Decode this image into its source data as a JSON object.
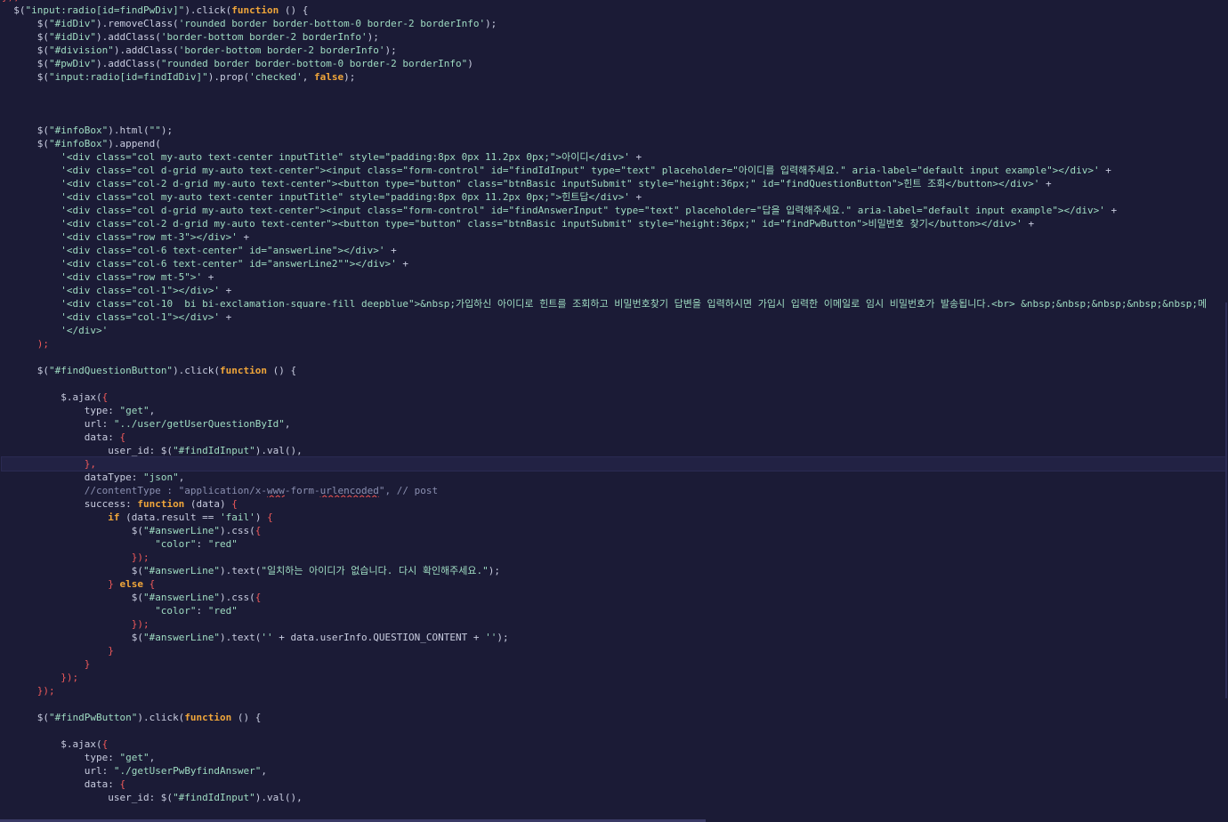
{
  "colors": {
    "background": "#1b1b36",
    "current_line": "#222244",
    "plain": "#c9cde0",
    "string": "#9fdcc2",
    "keyword": "#f0a63a",
    "punctuation": "#f05a5a",
    "comment": "#8a8fb0"
  },
  "editor": {
    "current_line_index": 35,
    "lines": [
      [
        [
          "punc",
          "});"
        ]
      ],
      [
        [
          "plain",
          "  $("
        ],
        [
          "str",
          "\"input:radio[id=findPwDiv]\""
        ],
        [
          "plain",
          ").click("
        ],
        [
          "kw",
          "function"
        ],
        [
          "plain",
          " () {"
        ]
      ],
      [
        [
          "plain",
          "      $("
        ],
        [
          "str",
          "\"#idDiv\""
        ],
        [
          "plain",
          ").removeClass("
        ],
        [
          "str",
          "'rounded border border-bottom-0 border-2 borderInfo'"
        ],
        [
          "plain",
          ");"
        ]
      ],
      [
        [
          "plain",
          "      $("
        ],
        [
          "str",
          "\"#idDiv\""
        ],
        [
          "plain",
          ").addClass("
        ],
        [
          "str",
          "'border-bottom border-2 borderInfo'"
        ],
        [
          "plain",
          ");"
        ]
      ],
      [
        [
          "plain",
          "      $("
        ],
        [
          "str",
          "\"#division\""
        ],
        [
          "plain",
          ").addClass("
        ],
        [
          "str",
          "'border-bottom border-2 borderInfo'"
        ],
        [
          "plain",
          ");"
        ]
      ],
      [
        [
          "plain",
          "      $("
        ],
        [
          "str",
          "\"#pwDiv\""
        ],
        [
          "plain",
          ").addClass("
        ],
        [
          "str",
          "\"rounded border border-bottom-0 border-2 borderInfo\""
        ],
        [
          "plain",
          ")"
        ]
      ],
      [
        [
          "plain",
          "      $("
        ],
        [
          "str",
          "\"input:radio[id=findIdDiv]\""
        ],
        [
          "plain",
          ").prop("
        ],
        [
          "str",
          "'checked'"
        ],
        [
          "plain",
          ", "
        ],
        [
          "kw",
          "false"
        ],
        [
          "plain",
          ");"
        ]
      ],
      [],
      [],
      [],
      [
        [
          "plain",
          "      $("
        ],
        [
          "str",
          "\"#infoBox\""
        ],
        [
          "plain",
          ").html("
        ],
        [
          "str",
          "\"\""
        ],
        [
          "plain",
          ");"
        ]
      ],
      [
        [
          "plain",
          "      $("
        ],
        [
          "str",
          "\"#infoBox\""
        ],
        [
          "plain",
          ").append("
        ]
      ],
      [
        [
          "plain",
          "          "
        ],
        [
          "str",
          "'<div class=\"col my-auto text-center inputTitle\" style=\"padding:8px 0px 11.2px 0px;\">아이디</div>'"
        ],
        [
          "plain",
          " +"
        ]
      ],
      [
        [
          "plain",
          "          "
        ],
        [
          "str",
          "'<div class=\"col d-grid my-auto text-center\"><input class=\"form-control\" id=\"findIdInput\" type=\"text\" placeholder=\"아이디를 입력해주세요.\" aria-label=\"default input example\"></div>'"
        ],
        [
          "plain",
          " +"
        ]
      ],
      [
        [
          "plain",
          "          "
        ],
        [
          "str",
          "'<div class=\"col-2 d-grid my-auto text-center\"><button type=\"button\" class=\"btnBasic inputSubmit\" style=\"height:36px;\" id=\"findQuestionButton\">힌트 조회</button></div>'"
        ],
        [
          "plain",
          " +"
        ]
      ],
      [
        [
          "plain",
          "          "
        ],
        [
          "str",
          "'<div class=\"col my-auto text-center inputTitle\" style=\"padding:8px 0px 11.2px 0px;\">힌트답</div>'"
        ],
        [
          "plain",
          " +"
        ]
      ],
      [
        [
          "plain",
          "          "
        ],
        [
          "str",
          "'<div class=\"col d-grid my-auto text-center\"><input class=\"form-control\" id=\"findAnswerInput\" type=\"text\" placeholder=\"답을 입력해주세요.\" aria-label=\"default input example\"></div>'"
        ],
        [
          "plain",
          " +"
        ]
      ],
      [
        [
          "plain",
          "          "
        ],
        [
          "str",
          "'<div class=\"col-2 d-grid my-auto text-center\"><button type=\"button\" class=\"btnBasic inputSubmit\" style=\"height:36px;\" id=\"findPwButton\">비밀번호 찾기</button></div>'"
        ],
        [
          "plain",
          " +"
        ]
      ],
      [
        [
          "plain",
          "          "
        ],
        [
          "str",
          "'<div class=\"row mt-3\"></div>'"
        ],
        [
          "plain",
          " +"
        ]
      ],
      [
        [
          "plain",
          "          "
        ],
        [
          "str",
          "'<div class=\"col-6 text-center\" id=\"answerLine\"></div>'"
        ],
        [
          "plain",
          " +"
        ]
      ],
      [
        [
          "plain",
          "          "
        ],
        [
          "str",
          "'<div class=\"col-6 text-center\" id=\"answerLine2\"\"></div>'"
        ],
        [
          "plain",
          " +"
        ]
      ],
      [
        [
          "plain",
          "          "
        ],
        [
          "str",
          "'<div class=\"row mt-5\">'"
        ],
        [
          "plain",
          " +"
        ]
      ],
      [
        [
          "plain",
          "          "
        ],
        [
          "str",
          "'<div class=\"col-1\"></div>'"
        ],
        [
          "plain",
          " +"
        ]
      ],
      [
        [
          "plain",
          "          "
        ],
        [
          "str",
          "'<div class=\"col-10  bi bi-exclamation-square-fill deepblue\">&nbsp;가입하신 아이디로 힌트를 조회하고 비밀번호찾기 답변을 입력하시면 가입시 입력한 이메일로 임시 비밀번호가 발송됩니다.<br> &nbsp;&nbsp;&nbsp;&nbsp;&nbsp;메"
        ]
      ],
      [
        [
          "plain",
          "          "
        ],
        [
          "str",
          "'<div class=\"col-1\"></div>'"
        ],
        [
          "plain",
          " +"
        ]
      ],
      [
        [
          "plain",
          "          "
        ],
        [
          "str",
          "'</div>'"
        ]
      ],
      [
        [
          "plain",
          "      "
        ],
        [
          "punc",
          ");"
        ]
      ],
      [],
      [
        [
          "plain",
          "      $("
        ],
        [
          "str",
          "\"#findQuestionButton\""
        ],
        [
          "plain",
          ").click("
        ],
        [
          "kw",
          "function"
        ],
        [
          "plain",
          " () {"
        ]
      ],
      [],
      [
        [
          "plain",
          "          $.ajax("
        ],
        [
          "punc",
          "{"
        ]
      ],
      [
        [
          "plain",
          "              type: "
        ],
        [
          "str",
          "\"get\""
        ],
        [
          "plain",
          ","
        ]
      ],
      [
        [
          "plain",
          "              url: "
        ],
        [
          "str",
          "\"../user/getUserQuestionById\""
        ],
        [
          "plain",
          ","
        ]
      ],
      [
        [
          "plain",
          "              data: "
        ],
        [
          "punc",
          "{"
        ]
      ],
      [
        [
          "plain",
          "                  user_id: $("
        ],
        [
          "str",
          "\"#findIdInput\""
        ],
        [
          "plain",
          ").val(),"
        ]
      ],
      [
        [
          "plain",
          "              "
        ],
        [
          "punc",
          "},"
        ]
      ],
      [
        [
          "plain",
          "              dataType: "
        ],
        [
          "str",
          "\"json\""
        ],
        [
          "plain",
          ","
        ]
      ],
      [
        [
          "comment",
          "              //contentType : \"application/x-"
        ],
        [
          "squig",
          "www"
        ],
        [
          "comment",
          "-form-"
        ],
        [
          "squig",
          "urlencoded"
        ],
        [
          "comment",
          "\", // post"
        ]
      ],
      [
        [
          "plain",
          "              success: "
        ],
        [
          "kw",
          "function"
        ],
        [
          "plain",
          " (data) "
        ],
        [
          "punc",
          "{"
        ]
      ],
      [
        [
          "plain",
          "                  "
        ],
        [
          "kw",
          "if"
        ],
        [
          "plain",
          " (data.result == "
        ],
        [
          "str",
          "'fail'"
        ],
        [
          "plain",
          ") "
        ],
        [
          "punc",
          "{"
        ]
      ],
      [
        [
          "plain",
          "                      $("
        ],
        [
          "str",
          "\"#answerLine\""
        ],
        [
          "plain",
          ").css("
        ],
        [
          "punc",
          "{"
        ]
      ],
      [
        [
          "plain",
          "                          "
        ],
        [
          "str",
          "\"color\""
        ],
        [
          "plain",
          ": "
        ],
        [
          "str",
          "\"red\""
        ]
      ],
      [
        [
          "plain",
          "                      "
        ],
        [
          "punc",
          "});"
        ]
      ],
      [
        [
          "plain",
          "                      $("
        ],
        [
          "str",
          "\"#answerLine\""
        ],
        [
          "plain",
          ").text("
        ],
        [
          "str",
          "\"일치하는 아이디가 없습니다. 다시 확인해주세요.\""
        ],
        [
          "plain",
          ");"
        ]
      ],
      [
        [
          "plain",
          "                  "
        ],
        [
          "punc",
          "}"
        ],
        [
          "plain",
          " "
        ],
        [
          "kw",
          "else"
        ],
        [
          "plain",
          " "
        ],
        [
          "punc",
          "{"
        ]
      ],
      [
        [
          "plain",
          "                      $("
        ],
        [
          "str",
          "\"#answerLine\""
        ],
        [
          "plain",
          ").css("
        ],
        [
          "punc",
          "{"
        ]
      ],
      [
        [
          "plain",
          "                          "
        ],
        [
          "str",
          "\"color\""
        ],
        [
          "plain",
          ": "
        ],
        [
          "str",
          "\"red\""
        ]
      ],
      [
        [
          "plain",
          "                      "
        ],
        [
          "punc",
          "});"
        ]
      ],
      [
        [
          "plain",
          "                      $("
        ],
        [
          "str",
          "\"#answerLine\""
        ],
        [
          "plain",
          ").text("
        ],
        [
          "str",
          "''"
        ],
        [
          "plain",
          " + data.userInfo.QUESTION_CONTENT + "
        ],
        [
          "str",
          "''"
        ],
        [
          "plain",
          ");"
        ]
      ],
      [
        [
          "plain",
          "                  "
        ],
        [
          "punc",
          "}"
        ]
      ],
      [
        [
          "plain",
          "              "
        ],
        [
          "punc",
          "}"
        ]
      ],
      [
        [
          "plain",
          "          "
        ],
        [
          "punc",
          "});"
        ]
      ],
      [
        [
          "plain",
          "      "
        ],
        [
          "punc",
          "});"
        ]
      ],
      [],
      [
        [
          "plain",
          "      $("
        ],
        [
          "str",
          "\"#findPwButton\""
        ],
        [
          "plain",
          ").click("
        ],
        [
          "kw",
          "function"
        ],
        [
          "plain",
          " () {"
        ]
      ],
      [],
      [
        [
          "plain",
          "          $.ajax("
        ],
        [
          "punc",
          "{"
        ]
      ],
      [
        [
          "plain",
          "              type: "
        ],
        [
          "str",
          "\"get\""
        ],
        [
          "plain",
          ","
        ]
      ],
      [
        [
          "plain",
          "              url: "
        ],
        [
          "str",
          "\"./getUserPwByfindAnswer\""
        ],
        [
          "plain",
          ","
        ]
      ],
      [
        [
          "plain",
          "              data: "
        ],
        [
          "punc",
          "{"
        ]
      ],
      [
        [
          "plain",
          "                  user_id: $("
        ],
        [
          "str",
          "\"#findIdInput\""
        ],
        [
          "plain",
          ").val(),"
        ]
      ]
    ]
  }
}
